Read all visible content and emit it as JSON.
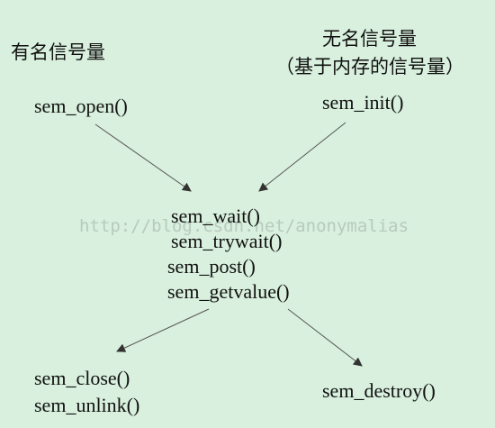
{
  "named": {
    "heading": "有名信号量",
    "open": "sem_open()",
    "close": "sem_close()",
    "unlink": "sem_unlink()"
  },
  "unnamed": {
    "heading": "无名信号量",
    "subheading": "（基于内存的信号量）",
    "init": "sem_init()",
    "destroy": "sem_destroy()"
  },
  "common": [
    "sem_wait()",
    "sem_trywait()",
    "sem_post()",
    "sem_getvalue()"
  ],
  "watermark": "http://blog.csdn.net/anonymalias",
  "colors": {
    "background": "#d8f0dd",
    "text": "#111111",
    "arrow": "#333333"
  }
}
